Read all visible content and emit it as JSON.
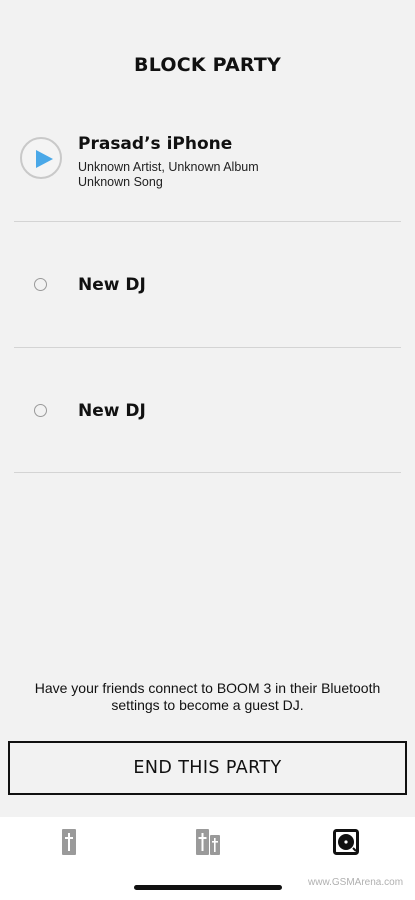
{
  "header": {
    "title": "BLOCK PARTY"
  },
  "djs": [
    {
      "name": "Prasad’s iPhone",
      "artist_album": "Unknown Artist, Unknown Album",
      "song": "Unknown Song",
      "state": "playing",
      "control_icon": "play-icon"
    },
    {
      "name": "New DJ",
      "state": "empty",
      "control_icon": "radio-circle-icon"
    },
    {
      "name": "New DJ",
      "state": "empty",
      "control_icon": "radio-circle-icon"
    }
  ],
  "hint": {
    "text": "Have your friends connect to BOOM 3 in their Bluetooth settings to become a guest DJ."
  },
  "end_button": {
    "label": "END THIS PARTY"
  },
  "tabbar": {
    "tabs": [
      {
        "icon": "single-speaker-icon",
        "active": false
      },
      {
        "icon": "multi-speaker-icon",
        "active": false
      },
      {
        "icon": "turntable-icon",
        "active": true
      }
    ]
  },
  "watermark": "www.GSMArena.com",
  "colors": {
    "accent": "#4aa8e8",
    "background": "#f2f2f2",
    "divider": "#d4d4d4",
    "inactive_icon": "#9a9a9a",
    "active_icon": "#111111"
  }
}
